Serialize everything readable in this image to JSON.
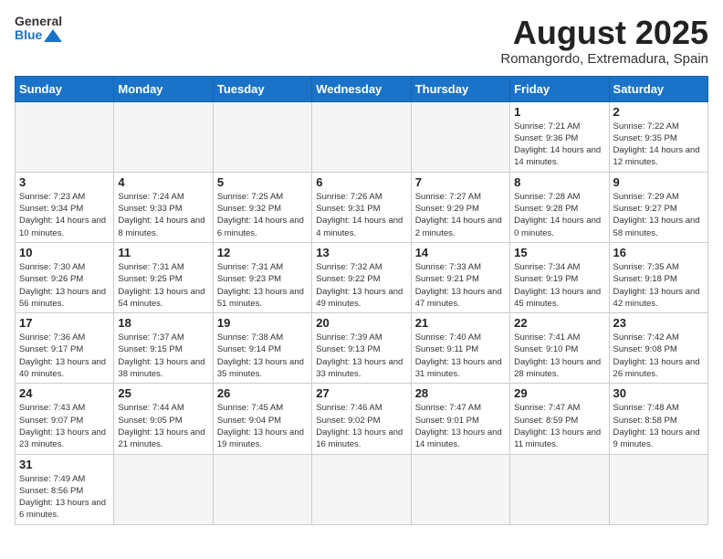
{
  "header": {
    "logo_general": "General",
    "logo_blue": "Blue",
    "month_title": "August 2025",
    "subtitle": "Romangordo, Extremadura, Spain"
  },
  "days_of_week": [
    "Sunday",
    "Monday",
    "Tuesday",
    "Wednesday",
    "Thursday",
    "Friday",
    "Saturday"
  ],
  "weeks": [
    [
      {
        "day": "",
        "info": ""
      },
      {
        "day": "",
        "info": ""
      },
      {
        "day": "",
        "info": ""
      },
      {
        "day": "",
        "info": ""
      },
      {
        "day": "",
        "info": ""
      },
      {
        "day": "1",
        "info": "Sunrise: 7:21 AM\nSunset: 9:36 PM\nDaylight: 14 hours and 14 minutes."
      },
      {
        "day": "2",
        "info": "Sunrise: 7:22 AM\nSunset: 9:35 PM\nDaylight: 14 hours and 12 minutes."
      }
    ],
    [
      {
        "day": "3",
        "info": "Sunrise: 7:23 AM\nSunset: 9:34 PM\nDaylight: 14 hours and 10 minutes."
      },
      {
        "day": "4",
        "info": "Sunrise: 7:24 AM\nSunset: 9:33 PM\nDaylight: 14 hours and 8 minutes."
      },
      {
        "day": "5",
        "info": "Sunrise: 7:25 AM\nSunset: 9:32 PM\nDaylight: 14 hours and 6 minutes."
      },
      {
        "day": "6",
        "info": "Sunrise: 7:26 AM\nSunset: 9:31 PM\nDaylight: 14 hours and 4 minutes."
      },
      {
        "day": "7",
        "info": "Sunrise: 7:27 AM\nSunset: 9:29 PM\nDaylight: 14 hours and 2 minutes."
      },
      {
        "day": "8",
        "info": "Sunrise: 7:28 AM\nSunset: 9:28 PM\nDaylight: 14 hours and 0 minutes."
      },
      {
        "day": "9",
        "info": "Sunrise: 7:29 AM\nSunset: 9:27 PM\nDaylight: 13 hours and 58 minutes."
      }
    ],
    [
      {
        "day": "10",
        "info": "Sunrise: 7:30 AM\nSunset: 9:26 PM\nDaylight: 13 hours and 56 minutes."
      },
      {
        "day": "11",
        "info": "Sunrise: 7:31 AM\nSunset: 9:25 PM\nDaylight: 13 hours and 54 minutes."
      },
      {
        "day": "12",
        "info": "Sunrise: 7:31 AM\nSunset: 9:23 PM\nDaylight: 13 hours and 51 minutes."
      },
      {
        "day": "13",
        "info": "Sunrise: 7:32 AM\nSunset: 9:22 PM\nDaylight: 13 hours and 49 minutes."
      },
      {
        "day": "14",
        "info": "Sunrise: 7:33 AM\nSunset: 9:21 PM\nDaylight: 13 hours and 47 minutes."
      },
      {
        "day": "15",
        "info": "Sunrise: 7:34 AM\nSunset: 9:19 PM\nDaylight: 13 hours and 45 minutes."
      },
      {
        "day": "16",
        "info": "Sunrise: 7:35 AM\nSunset: 9:18 PM\nDaylight: 13 hours and 42 minutes."
      }
    ],
    [
      {
        "day": "17",
        "info": "Sunrise: 7:36 AM\nSunset: 9:17 PM\nDaylight: 13 hours and 40 minutes."
      },
      {
        "day": "18",
        "info": "Sunrise: 7:37 AM\nSunset: 9:15 PM\nDaylight: 13 hours and 38 minutes."
      },
      {
        "day": "19",
        "info": "Sunrise: 7:38 AM\nSunset: 9:14 PM\nDaylight: 13 hours and 35 minutes."
      },
      {
        "day": "20",
        "info": "Sunrise: 7:39 AM\nSunset: 9:13 PM\nDaylight: 13 hours and 33 minutes."
      },
      {
        "day": "21",
        "info": "Sunrise: 7:40 AM\nSunset: 9:11 PM\nDaylight: 13 hours and 31 minutes."
      },
      {
        "day": "22",
        "info": "Sunrise: 7:41 AM\nSunset: 9:10 PM\nDaylight: 13 hours and 28 minutes."
      },
      {
        "day": "23",
        "info": "Sunrise: 7:42 AM\nSunset: 9:08 PM\nDaylight: 13 hours and 26 minutes."
      }
    ],
    [
      {
        "day": "24",
        "info": "Sunrise: 7:43 AM\nSunset: 9:07 PM\nDaylight: 13 hours and 23 minutes."
      },
      {
        "day": "25",
        "info": "Sunrise: 7:44 AM\nSunset: 9:05 PM\nDaylight: 13 hours and 21 minutes."
      },
      {
        "day": "26",
        "info": "Sunrise: 7:45 AM\nSunset: 9:04 PM\nDaylight: 13 hours and 19 minutes."
      },
      {
        "day": "27",
        "info": "Sunrise: 7:46 AM\nSunset: 9:02 PM\nDaylight: 13 hours and 16 minutes."
      },
      {
        "day": "28",
        "info": "Sunrise: 7:47 AM\nSunset: 9:01 PM\nDaylight: 13 hours and 14 minutes."
      },
      {
        "day": "29",
        "info": "Sunrise: 7:47 AM\nSunset: 8:59 PM\nDaylight: 13 hours and 11 minutes."
      },
      {
        "day": "30",
        "info": "Sunrise: 7:48 AM\nSunset: 8:58 PM\nDaylight: 13 hours and 9 minutes."
      }
    ],
    [
      {
        "day": "31",
        "info": "Sunrise: 7:49 AM\nSunset: 8:56 PM\nDaylight: 13 hours and 6 minutes."
      },
      {
        "day": "",
        "info": ""
      },
      {
        "day": "",
        "info": ""
      },
      {
        "day": "",
        "info": ""
      },
      {
        "day": "",
        "info": ""
      },
      {
        "day": "",
        "info": ""
      },
      {
        "day": "",
        "info": ""
      }
    ]
  ]
}
